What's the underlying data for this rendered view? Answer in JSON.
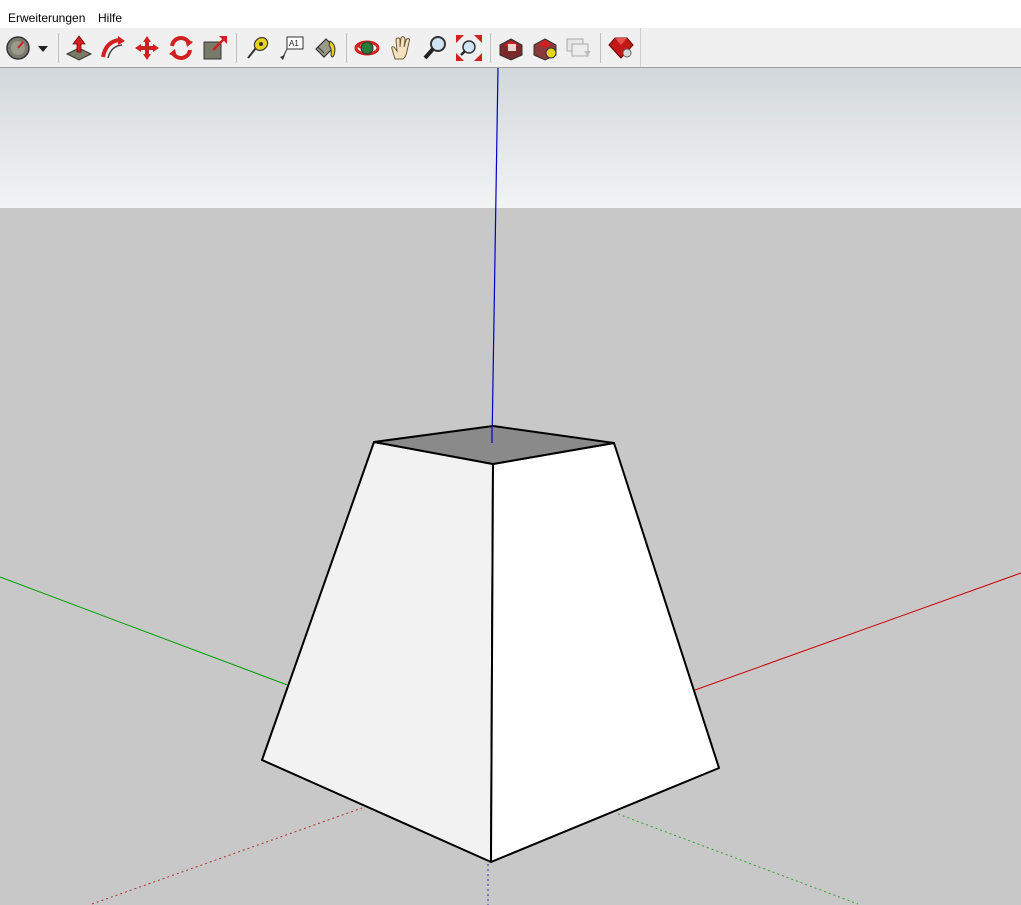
{
  "menu": {
    "items": [
      {
        "label": "Erweiterungen"
      },
      {
        "label": "Hilfe"
      }
    ]
  },
  "toolbar": {
    "tools": [
      {
        "icon": "select-icon"
      },
      {
        "icon": "dropdown-arrow-icon"
      },
      {
        "icon": "push-pull-icon"
      },
      {
        "icon": "follow-me-icon"
      },
      {
        "icon": "move-icon"
      },
      {
        "icon": "rotate-icon"
      },
      {
        "icon": "scale-icon"
      },
      {
        "icon": "tape-measure-icon"
      },
      {
        "icon": "text-label-icon"
      },
      {
        "icon": "paint-bucket-icon"
      },
      {
        "icon": "orbit-icon"
      },
      {
        "icon": "pan-icon"
      },
      {
        "icon": "zoom-icon"
      },
      {
        "icon": "zoom-extents-icon"
      },
      {
        "icon": "warehouse-icon"
      },
      {
        "icon": "extension-warehouse-icon"
      },
      {
        "icon": "layout-icon"
      },
      {
        "icon": "ruby-console-icon"
      }
    ],
    "text_tool_label": "A1"
  },
  "scene": {
    "sky_color": "#dfe4e7",
    "ground_color": "#c8c8c8",
    "axis_colors": {
      "red": "#cc0000",
      "green": "#00aa00",
      "blue": "#0000cc"
    },
    "face_left_color": "#f2f2f2",
    "face_right_color": "#ffffff",
    "face_top_color": "#8a8a8a"
  }
}
